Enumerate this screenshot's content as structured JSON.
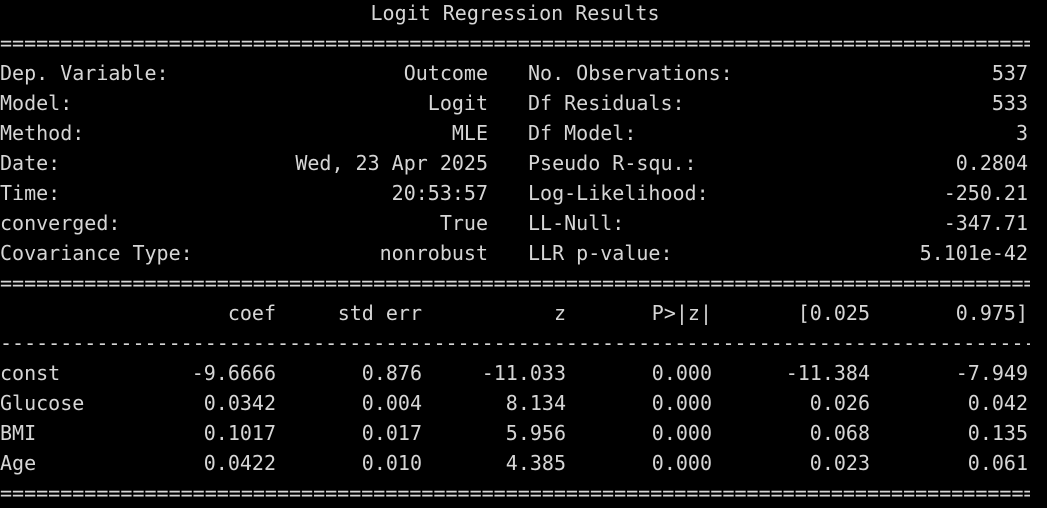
{
  "title": "Logit Regression Results",
  "rules": {
    "double": "===========================================================================================================",
    "single": "-----------------------------------------------------------------------------------------------------------"
  },
  "info": {
    "left": [
      {
        "label": "Dep. Variable:",
        "value": "Outcome"
      },
      {
        "label": "Model:",
        "value": "Logit"
      },
      {
        "label": "Method:",
        "value": "MLE"
      },
      {
        "label": "Date:",
        "value": "Wed, 23 Apr 2025"
      },
      {
        "label": "Time:",
        "value": "20:53:57"
      },
      {
        "label": "converged:",
        "value": "True"
      },
      {
        "label": "Covariance Type:",
        "value": "nonrobust"
      }
    ],
    "right": [
      {
        "label": "No. Observations:",
        "value": "537"
      },
      {
        "label": "Df Residuals:",
        "value": "533"
      },
      {
        "label": "Df Model:",
        "value": "3"
      },
      {
        "label": "Pseudo R-squ.:",
        "value": "0.2804"
      },
      {
        "label": "Log-Likelihood:",
        "value": "-250.21"
      },
      {
        "label": "LL-Null:",
        "value": "-347.71"
      },
      {
        "label": "LLR p-value:",
        "value": "5.101e-42"
      }
    ]
  },
  "table": {
    "headers": [
      "coef",
      "std err",
      "z",
      "P>|z|",
      "[0.025",
      "0.975]"
    ],
    "rows": [
      {
        "name": "const",
        "values": [
          "-9.6666",
          "0.876",
          "-11.033",
          "0.000",
          "-11.384",
          "-7.949"
        ]
      },
      {
        "name": "Glucose",
        "values": [
          "0.0342",
          "0.004",
          "8.134",
          "0.000",
          "0.026",
          "0.042"
        ]
      },
      {
        "name": "BMI",
        "values": [
          "0.1017",
          "0.017",
          "5.956",
          "0.000",
          "0.068",
          "0.135"
        ]
      },
      {
        "name": "Age",
        "values": [
          "0.0422",
          "0.010",
          "4.385",
          "0.000",
          "0.023",
          "0.061"
        ]
      }
    ]
  },
  "colors": {
    "background": "#000000",
    "text": "#d6d6d6"
  }
}
